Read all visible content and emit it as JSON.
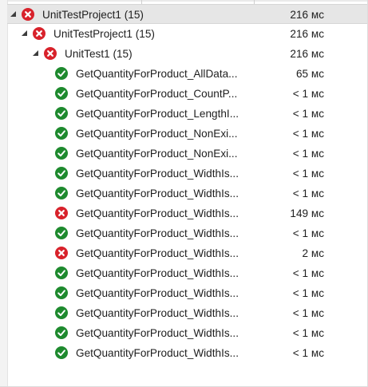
{
  "colors": {
    "pass": "#1e8a2e",
    "fail": "#d8222b",
    "selected_row": "#e6e6e6"
  },
  "tree": [
    {
      "name": "UnitTestProject1",
      "count": "(15)",
      "duration": "216 мс",
      "status": "fail",
      "level": 0,
      "expanded": true,
      "selected": true
    },
    {
      "name": "UnitTestProject1",
      "count": "(15)",
      "duration": "216 мс",
      "status": "fail",
      "level": 1,
      "expanded": true
    },
    {
      "name": "UnitTest1",
      "count": "(15)",
      "duration": "216 мс",
      "status": "fail",
      "level": 2,
      "expanded": true
    },
    {
      "name": "GetQuantityForProduct_AllData...",
      "duration": "65 мс",
      "status": "pass",
      "level": 3
    },
    {
      "name": "GetQuantityForProduct_CountP...",
      "duration": "< 1 мс",
      "status": "pass",
      "level": 3
    },
    {
      "name": "GetQuantityForProduct_LengthI...",
      "duration": "< 1 мс",
      "status": "pass",
      "level": 3
    },
    {
      "name": "GetQuantityForProduct_NonExi...",
      "duration": "< 1 мс",
      "status": "pass",
      "level": 3
    },
    {
      "name": "GetQuantityForProduct_NonExi...",
      "duration": "< 1 мс",
      "status": "pass",
      "level": 3
    },
    {
      "name": "GetQuantityForProduct_WidthIs...",
      "duration": "< 1 мс",
      "status": "pass",
      "level": 3
    },
    {
      "name": "GetQuantityForProduct_WidthIs...",
      "duration": "< 1 мс",
      "status": "pass",
      "level": 3
    },
    {
      "name": "GetQuantityForProduct_WidthIs...",
      "duration": "149 мс",
      "status": "fail",
      "level": 3
    },
    {
      "name": "GetQuantityForProduct_WidthIs...",
      "duration": "< 1 мс",
      "status": "pass",
      "level": 3
    },
    {
      "name": "GetQuantityForProduct_WidthIs...",
      "duration": "2 мс",
      "status": "fail",
      "level": 3
    },
    {
      "name": "GetQuantityForProduct_WidthIs...",
      "duration": "< 1 мс",
      "status": "pass",
      "level": 3
    },
    {
      "name": "GetQuantityForProduct_WidthIs...",
      "duration": "< 1 мс",
      "status": "pass",
      "level": 3
    },
    {
      "name": "GetQuantityForProduct_WidthIs...",
      "duration": "< 1 мс",
      "status": "pass",
      "level": 3
    },
    {
      "name": "GetQuantityForProduct_WidthIs...",
      "duration": "< 1 мс",
      "status": "pass",
      "level": 3
    },
    {
      "name": "GetQuantityForProduct_WidthIs...",
      "duration": "< 1 мс",
      "status": "pass",
      "level": 3
    }
  ]
}
